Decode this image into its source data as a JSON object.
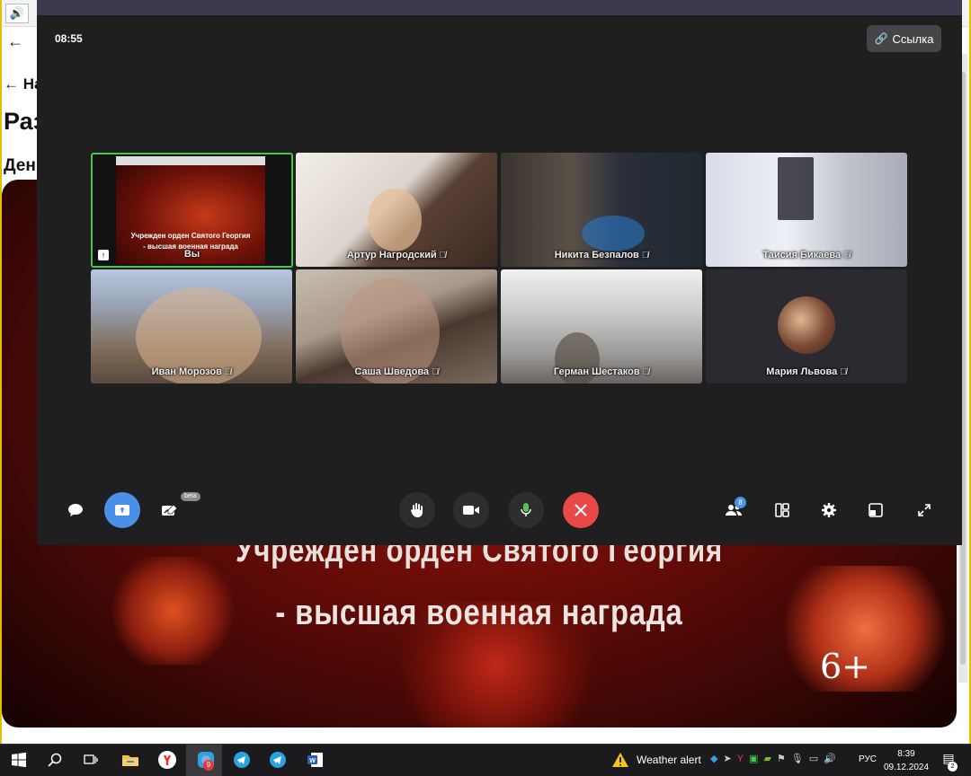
{
  "background": {
    "nav_text": "← На",
    "title_text": "Раз",
    "subtitle_text": "Ден",
    "video_line1": "Учрежден орден Святого Георгия",
    "video_line2": "- высшая военная награда",
    "age_rating": "6+"
  },
  "conference": {
    "timer": "08:55",
    "link_button": "Ссылка",
    "self_label": "Вы",
    "self_screen_line1": "Учрежден орден Святого Георгия",
    "self_screen_line2": "- высшая военная награда",
    "participants": [
      {
        "name": "Вы"
      },
      {
        "name": "Артур Нагродский"
      },
      {
        "name": "Никита Безпалов"
      },
      {
        "name": "Таисия Бикаева"
      },
      {
        "name": "Иван Морозов"
      },
      {
        "name": "Саша Шведова"
      },
      {
        "name": "Герман Шестаков"
      },
      {
        "name": "Мария Львова"
      }
    ],
    "beta_badge": "beta",
    "participants_count": "8",
    "colors": {
      "accent": "#4a8fe8",
      "end_call": "#e84848",
      "active_speaker": "#4cc24c"
    }
  },
  "taskbar": {
    "weather": "Weather alert",
    "language": "РУС",
    "time": "8:39",
    "date": "09.12.2024",
    "app_badge": "9",
    "notifications_count": "2",
    "icons": [
      "windows-start-icon",
      "search-icon",
      "task-view-icon",
      "file-explorer-icon",
      "yandex-browser-icon",
      "messenger-icon",
      "telegram-icon",
      "telegram-icon",
      "word-icon"
    ]
  }
}
